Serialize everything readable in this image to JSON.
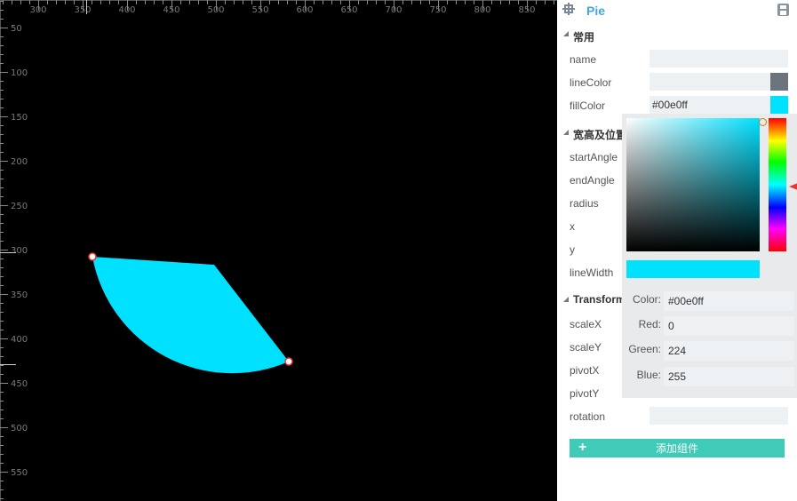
{
  "canvas": {
    "pie_fill": "#00e0ff",
    "ruler_top": [
      "300",
      "350",
      "400",
      "450",
      "500",
      "550",
      "600",
      "650",
      "700",
      "750",
      "800",
      "850"
    ],
    "ruler_left": [
      "50",
      "100",
      "150",
      "200",
      "250",
      "300",
      "350",
      "400",
      "450",
      "500",
      "550"
    ]
  },
  "panel": {
    "title": "Pie",
    "sections": {
      "common": "常用",
      "size_position": "宽高及位置",
      "transform": "Transform"
    },
    "fields": {
      "name": {
        "label": "name",
        "value": ""
      },
      "lineColor": {
        "label": "lineColor",
        "value": "",
        "swatch": "#6b737d"
      },
      "fillColor": {
        "label": "fillColor",
        "value": "#00e0ff",
        "swatch": "#00e0ff"
      },
      "startAngle": {
        "label": "startAngle"
      },
      "endAngle": {
        "label": "endAngle"
      },
      "radius": {
        "label": "radius"
      },
      "x": {
        "label": "x"
      },
      "y": {
        "label": "y"
      },
      "lineWidth": {
        "label": "lineWidth"
      },
      "scaleX": {
        "label": "scaleX"
      },
      "scaleY": {
        "label": "scaleY"
      },
      "pivotX": {
        "label": "pivotX"
      },
      "pivotY": {
        "label": "pivotY"
      },
      "rotation": {
        "label": "rotation",
        "value": ""
      }
    },
    "add_button": "添加组件"
  },
  "picker": {
    "hue_color": "#00e0ff",
    "preview_color": "#00e0ff",
    "color_label": "Color:",
    "color_value": "#00e0ff",
    "red_label": "Red:",
    "red_value": "0",
    "green_label": "Green:",
    "green_value": "224",
    "blue_label": "Blue:",
    "blue_value": "255"
  }
}
